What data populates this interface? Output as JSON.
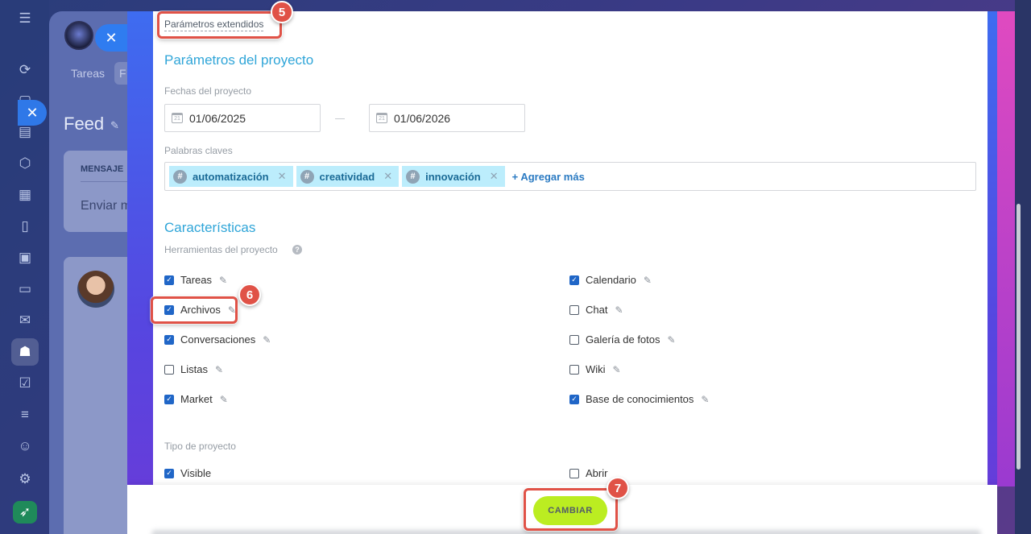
{
  "sidebar": {
    "icons": [
      "menu-icon",
      "flow-icon",
      "chat-icon",
      "document-icon",
      "hexagon-icon",
      "calendar-icon",
      "file-icon",
      "presentation-icon",
      "card-icon",
      "mail-icon",
      "people-icon",
      "check-icon",
      "funnel-icon",
      "robot-icon",
      "gear-icon",
      "rocket-icon"
    ]
  },
  "background": {
    "tab_tareas": "Tareas",
    "tab_other": "F",
    "feed_title": "Feed",
    "card_label": "MENSAJE",
    "card_placeholder": "Enviar m"
  },
  "panel": {
    "extended_link": "Parámetros extendidos",
    "project_params_title": "Parámetros del proyecto",
    "dates_label": "Fechas del proyecto",
    "date_start": "01/06/2025",
    "date_end": "01/06/2026",
    "keywords_label": "Palabras claves",
    "tags": [
      {
        "text": "automatización"
      },
      {
        "text": "creatividad"
      },
      {
        "text": "innovación"
      }
    ],
    "add_more": "+ Agregar más",
    "features_title": "Características",
    "tools_label": "Herramientas del proyecto",
    "tools_left": [
      {
        "label": "Tareas",
        "checked": true
      },
      {
        "label": "Archivos",
        "checked": true
      },
      {
        "label": "Conversaciones",
        "checked": true
      },
      {
        "label": "Listas",
        "checked": false
      },
      {
        "label": "Market",
        "checked": true
      }
    ],
    "tools_right": [
      {
        "label": "Calendario",
        "checked": true
      },
      {
        "label": "Chat",
        "checked": false
      },
      {
        "label": "Galería de fotos",
        "checked": false
      },
      {
        "label": "Wiki",
        "checked": false
      },
      {
        "label": "Base de conocimientos",
        "checked": true
      }
    ],
    "type_label": "Tipo de proyecto",
    "type_left": {
      "label": "Visible",
      "checked": true
    },
    "type_right": {
      "label": "Abrir",
      "checked": false
    }
  },
  "footer": {
    "save_button": "CAMBIAR"
  },
  "annotations": {
    "badge_5": "5",
    "badge_6": "6",
    "badge_7": "7",
    "highlight_color": "#e05247"
  }
}
